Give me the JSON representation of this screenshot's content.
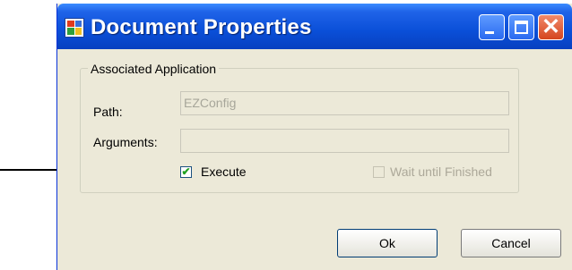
{
  "window": {
    "title": "Document Properties"
  },
  "group": {
    "legend": "Associated Application",
    "path_label": "Path:",
    "path_value": "EZConfig",
    "arguments_label": "Arguments:",
    "arguments_value": "",
    "execute_label": "Execute",
    "execute_checked": true,
    "execute_check_glyph": "✔",
    "wait_label": "Wait until Finished",
    "wait_checked": false,
    "wait_enabled": false
  },
  "buttons": {
    "ok_label": "Ok",
    "cancel_label": "Cancel"
  },
  "titlebar_buttons": {
    "close_glyph": "✕"
  },
  "icons": {
    "app": "app-icon",
    "minimize": "minimize-icon",
    "maximize": "maximize-icon",
    "close": "close-icon",
    "annotation": "arrow-icon"
  },
  "colors": {
    "title_bar": "#0a4fd8",
    "dialog_bg": "#ece9d8",
    "close_button": "#d4451f"
  }
}
